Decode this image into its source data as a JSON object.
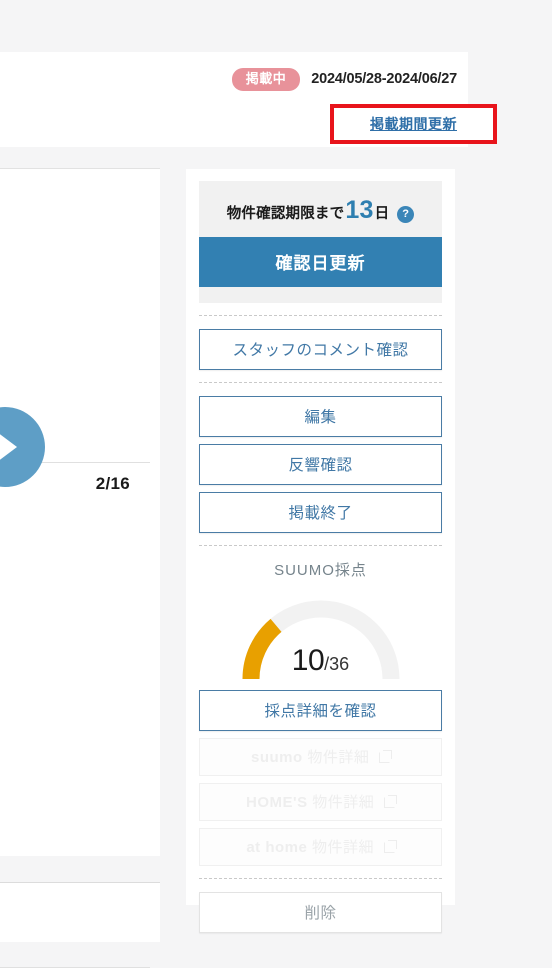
{
  "header": {
    "status_badge": "掲載中",
    "period": "2024/05/28-2024/06/27",
    "renew_link": "掲載期間更新"
  },
  "left_panel": {
    "pager": "2/16",
    "next_arrow_icon": "chevron-right-icon"
  },
  "side_panel": {
    "deadline": {
      "prefix": "物件確認期限まで",
      "days": "13",
      "suffix": "日",
      "help_icon": "?"
    },
    "primary_button": "確認日更新",
    "staff_comment_button": "スタッフのコメント確認",
    "actions": [
      "編集",
      "反響確認",
      "掲載終了"
    ],
    "score": {
      "title": "SUUMO採点",
      "value": "10",
      "denominator": "/36",
      "score_num": 10,
      "score_max": 36,
      "arc_color": "#e8a000",
      "track_color": "#f2f2f2"
    },
    "score_detail_button": "採点詳細を確認",
    "portal_links": [
      {
        "brand": "suumo",
        "label": "物件詳細",
        "icon": "external-link-icon"
      },
      {
        "brand": "HOME'S",
        "label": "物件詳細",
        "icon": "external-link-icon"
      },
      {
        "brand": "at home",
        "label": "物件詳細",
        "icon": "external-link-icon"
      }
    ],
    "delete_button": "削除"
  },
  "colors": {
    "page_bg": "#f5f5f6",
    "accent_blue": "#3280b2",
    "badge_pink": "#e8929a",
    "highlight_red": "#e8141b",
    "gauge_orange": "#e8a000"
  }
}
